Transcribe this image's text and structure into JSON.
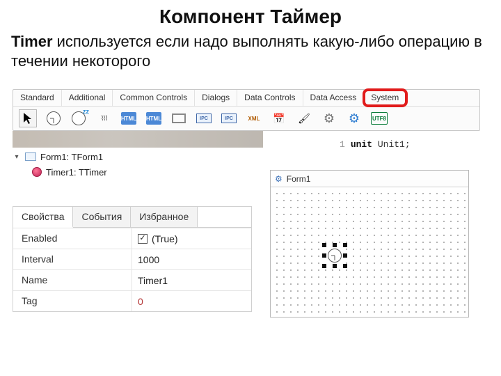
{
  "slide": {
    "title": "Компонент Таймер",
    "body_bold": "Timer",
    "body_rest": " используется если надо выполнять какую-либо операцию в течении некоторого"
  },
  "palette": {
    "tabs": [
      "Standard",
      "Additional",
      "Common Controls",
      "Dialogs",
      "Data Controls",
      "Data Access",
      "System"
    ],
    "highlighted_tab_index": 6,
    "icon_labels": {
      "arrow": "selection-tool",
      "clock": "timer",
      "sleep": "idle-timer",
      "waves": "process",
      "html1": "html-help",
      "html2": "html-browser",
      "box": "panel",
      "ipc1": "simple-ipc-client",
      "ipc2": "simple-ipc-server",
      "xml": "xml",
      "sched": "date-time",
      "paint": "paintbox",
      "gear1": "service",
      "gear2": "settings",
      "utf": "utf8"
    },
    "utf_text": "UTF8",
    "html_text": "HTML",
    "ipc_text": "IPC",
    "xml_text": "XML"
  },
  "object_tree": {
    "root": "Form1: TForm1",
    "child": "Timer1: TTimer"
  },
  "props": {
    "tabs": [
      "Свойства",
      "События",
      "Избранное"
    ],
    "active_tab_index": 0,
    "rows": [
      {
        "key": "Enabled",
        "val": "(True)",
        "checkbox": true,
        "checked": true
      },
      {
        "key": "Interval",
        "val": "1000"
      },
      {
        "key": "Name",
        "val": "Timer1"
      },
      {
        "key": "Tag",
        "val": "0",
        "tag_style": true
      }
    ]
  },
  "designer": {
    "form_caption": "Form1"
  },
  "code": {
    "line_no": "1",
    "kw": "unit",
    "ident": "Unit1;"
  }
}
